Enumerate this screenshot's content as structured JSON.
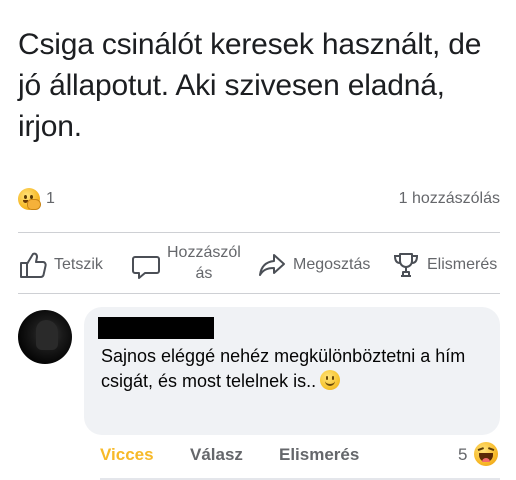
{
  "post": {
    "text": "Csiga csinálót keresek használt, de jó állapotut. Aki szivesen eladná, irjon."
  },
  "stats": {
    "reaction_icon": "care-reaction-icon",
    "reaction_count": "1",
    "comment_count_label": "1 hozzászólás"
  },
  "actions": {
    "like_label": "Tetszik",
    "comment_label_line1": "Hozzászól",
    "comment_label_line2": "ás",
    "share_label": "Megosztás",
    "award_label": "Elismerés"
  },
  "comment": {
    "author_name": "",
    "text": "Sajnos eléggé nehéz megkülönböztetni a hím csigát, és most telelnek is..",
    "emoji": "smiling-face-icon",
    "funny_label": "Vicces",
    "reply_label": "Válasz",
    "award_label": "Elismerés",
    "reaction_count": "5",
    "reaction_icon": "haha-reaction-icon"
  },
  "colors": {
    "funny_active": "#f7b928",
    "secondary_text": "#65676b",
    "bubble_bg": "#f0f2f5"
  }
}
